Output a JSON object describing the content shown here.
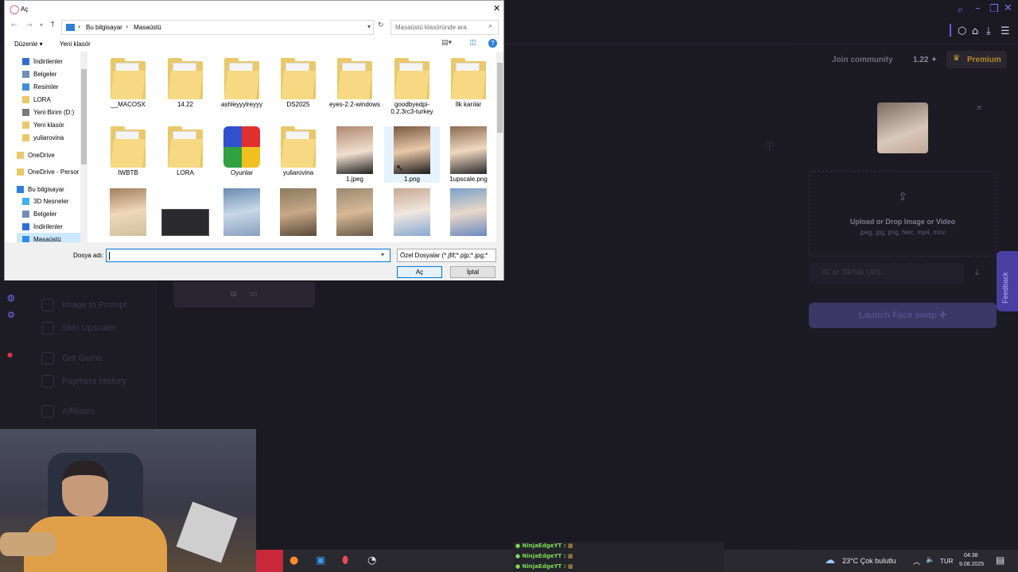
{
  "dialog": {
    "title": "Aç",
    "address": {
      "crumbs": [
        "Bu bilgisayar",
        "Masaüstü"
      ]
    },
    "search_placeholder": "Masaüstü klasöründe ara",
    "toolbar": {
      "organize": "Düzenle ▾",
      "new_folder": "Yeni klasör"
    },
    "nav": [
      {
        "label": "İndirilenler",
        "color": "#2f6fd3"
      },
      {
        "label": "Belgeler",
        "color": "#6f8fb5"
      },
      {
        "label": "Resimler",
        "color": "#3f8fd8"
      },
      {
        "label": "LORA",
        "color": "#e9c86a"
      },
      {
        "label": "Yeni Birim (D:)",
        "color": "#7a7a7a"
      },
      {
        "label": "Yeni klasör",
        "color": "#e9c86a"
      },
      {
        "label": "yuliarovina",
        "color": "#e9c86a"
      },
      {
        "label": "OneDrive",
        "color": "#e9c86a"
      },
      {
        "label": "OneDrive - Persor",
        "color": "#e9c86a"
      },
      {
        "label": "Bu bilgisayar",
        "color": "#2f7fd8"
      },
      {
        "label": "3D Nesneler",
        "color": "#3fb0e8"
      },
      {
        "label": "Belgeler",
        "color": "#6f8fb5"
      },
      {
        "label": "İndirilenler",
        "color": "#2f6fd3"
      },
      {
        "label": "Masaüstü",
        "color": "#2f8fe8"
      }
    ],
    "files": [
      {
        "name": "__MACOSX",
        "kind": "folder"
      },
      {
        "name": "14.22",
        "kind": "folder"
      },
      {
        "name": "ashleyyylreyyy",
        "kind": "folder"
      },
      {
        "name": "DS2025",
        "kind": "folder"
      },
      {
        "name": "eyes-2.2-windows",
        "kind": "folder"
      },
      {
        "name": "goodbyedpi-0.2.3rc3-turkey",
        "kind": "folder"
      },
      {
        "name": "İlk karılar",
        "kind": "folder"
      },
      {
        "name": "IWBTB",
        "kind": "folder"
      },
      {
        "name": "LORA",
        "kind": "folder"
      },
      {
        "name": "Oyunlar",
        "kind": "app"
      },
      {
        "name": "yuliarovina",
        "kind": "folder"
      },
      {
        "name": "1.jpeg",
        "kind": "photo"
      },
      {
        "name": "1.png",
        "kind": "photo"
      },
      {
        "name": "1upscale.png",
        "kind": "photo"
      },
      {
        "name": "",
        "kind": "photo"
      },
      {
        "name": "",
        "kind": "screen"
      },
      {
        "name": "",
        "kind": "photo"
      },
      {
        "name": "",
        "kind": "photo"
      },
      {
        "name": "",
        "kind": "photo"
      },
      {
        "name": "",
        "kind": "photo"
      },
      {
        "name": "",
        "kind": "photo"
      }
    ],
    "filename_label": "Dosya adı:",
    "filename_value": "",
    "filetype": "Özel Dosyalar (*.jfif;*.pjp;*.jpg;*",
    "open_label": "Aç",
    "cancel_label": "İptal"
  },
  "app": {
    "join": "Join community",
    "credits": "1.22",
    "premium": "Premium",
    "upload_title": "Upload or Drop Image or Video",
    "upload_formats": "jpeg, jpg, png, heic, mp4, mov",
    "url_placeholder": "IG or TikTok URL",
    "launch": "Launch Face swap",
    "feedback": "Feedback",
    "sidebar": [
      "Image to Prompt",
      "Skin Upscaler",
      "Get Gems",
      "Payment History",
      "Affiliates"
    ]
  },
  "chat": [
    {
      "user": "NinjaEdgeYT :"
    },
    {
      "user": "NinjaEdgeYT :"
    },
    {
      "user": "NinjaEdgeYT :"
    }
  ],
  "taskbar": {
    "weather": "23°C  Çok bulutlu",
    "lang": "TUR",
    "time": "04:38",
    "date": "9.08.2025"
  }
}
